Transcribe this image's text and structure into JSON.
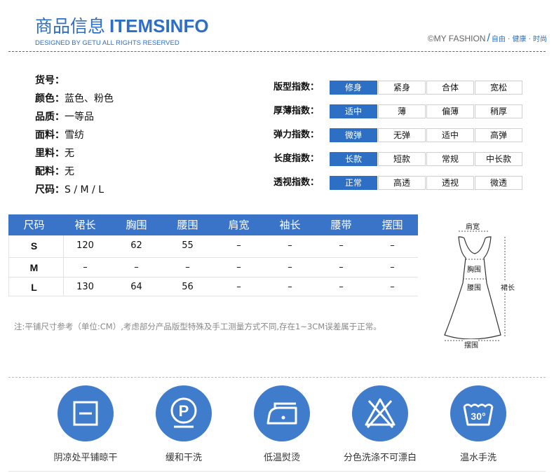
{
  "header": {
    "title_cn": "商品信息",
    "title_en": "ITEMSINFO",
    "subtitle": "DESIGNED BY GETU ALL RIGHTS RESERVED",
    "brand": "©MY FASHION",
    "slash": "/",
    "tagline": "自由 · 健康 · 时尚"
  },
  "info": [
    {
      "key": "货号：",
      "value": ""
    },
    {
      "key": "颜色：",
      "value": "蓝色、粉色"
    },
    {
      "key": "品质：",
      "value": "一等品"
    },
    {
      "key": "面料：",
      "value": "雪纺"
    },
    {
      "key": "里料：",
      "value": "无"
    },
    {
      "key": "配料：",
      "value": "无"
    },
    {
      "key": "尺码：",
      "value": "S / M / L"
    }
  ],
  "indices": [
    {
      "label": "版型指数：",
      "options": [
        "修身",
        "紧身",
        "合体",
        "宽松"
      ],
      "selected": 0
    },
    {
      "label": "厚薄指数：",
      "options": [
        "适中",
        "薄",
        "偏薄",
        "稍厚"
      ],
      "selected": 0
    },
    {
      "label": "弹力指数：",
      "options": [
        "微弹",
        "无弹",
        "适中",
        "高弹"
      ],
      "selected": 0
    },
    {
      "label": "长度指数：",
      "options": [
        "长款",
        "短款",
        "常规",
        "中长款"
      ],
      "selected": 0
    },
    {
      "label": "透视指数：",
      "options": [
        "正常",
        "高透",
        "透视",
        "微透"
      ],
      "selected": 0
    }
  ],
  "size_table": {
    "headers": [
      "尺码",
      "裙长",
      "胸围",
      "腰围",
      "肩宽",
      "袖长",
      "腰带",
      "摆围"
    ],
    "rows": [
      [
        "S",
        "120",
        "62",
        "55",
        "–",
        "–",
        "–",
        "–"
      ],
      [
        "M",
        "–",
        "–",
        "–",
        "–",
        "–",
        "–",
        "–"
      ],
      [
        "L",
        "130",
        "64",
        "56",
        "–",
        "–",
        "–",
        "–"
      ]
    ]
  },
  "note": "注:平铺尺寸参考（单位:CM）,考虑部分产品版型特殊及手工测量方式不同,存在1~3CM误差属于正常。",
  "diagram": {
    "shoulder": "肩宽",
    "chest": "胸围",
    "waist": "腰围",
    "length": "裙长",
    "hem": "摆围"
  },
  "care": [
    {
      "icon": "dry-flat-shade-icon",
      "label": "阴凉处平铺晾干"
    },
    {
      "icon": "gentle-dry-clean-icon",
      "label": "缓和干洗",
      "glyph": "P"
    },
    {
      "icon": "low-temp-iron-icon",
      "label": "低温熨烫"
    },
    {
      "icon": "no-bleach-icon",
      "label": "分色洗涤不可漂白"
    },
    {
      "icon": "hand-wash-icon",
      "label": "温水手洗",
      "glyph": "30°"
    }
  ],
  "colors": {
    "accent": "#2d6fc4",
    "table_head": "#3a74c9",
    "care_circle": "#3f7ccc"
  }
}
